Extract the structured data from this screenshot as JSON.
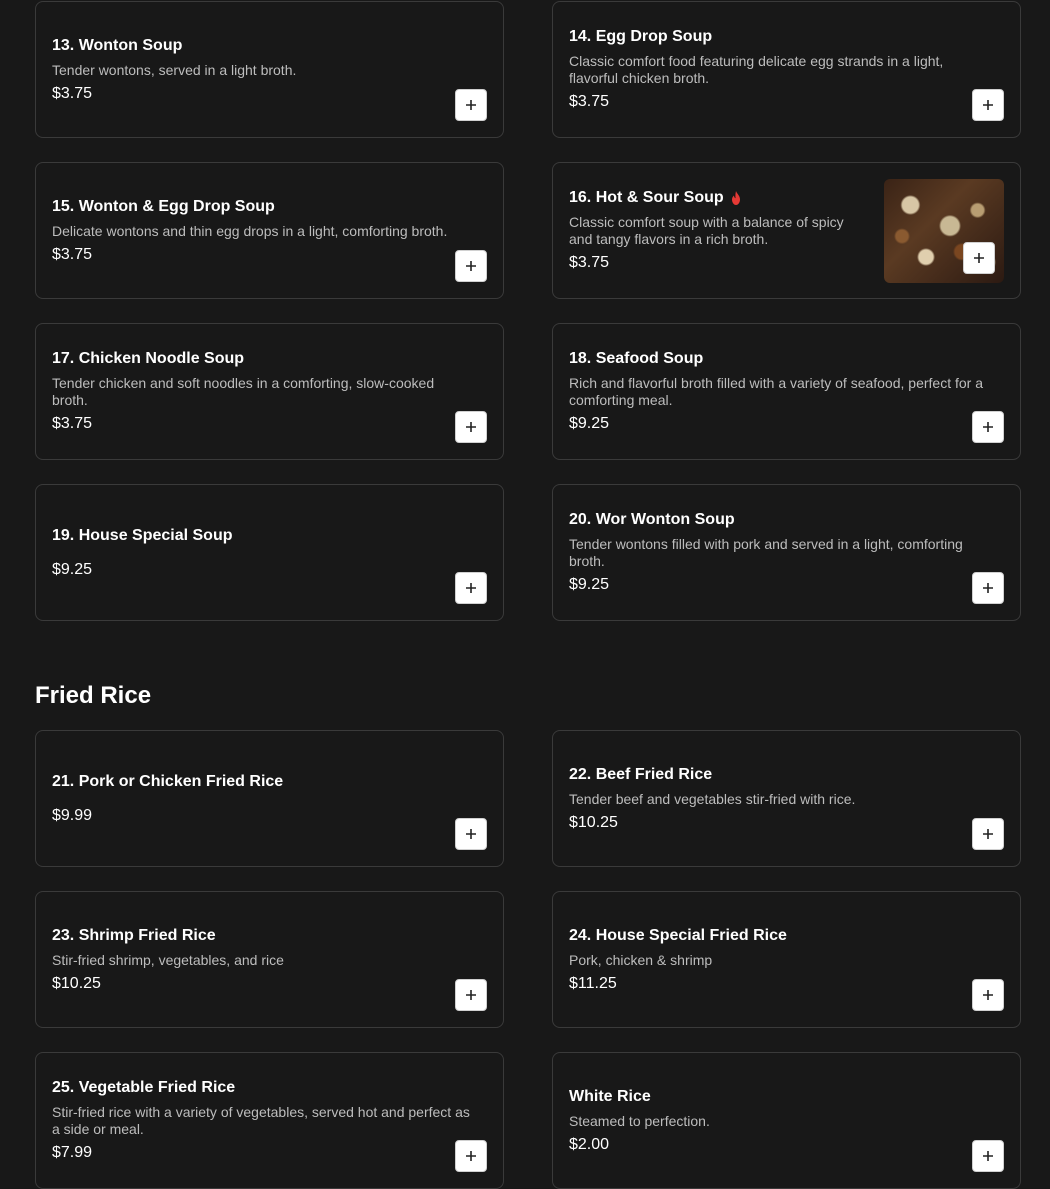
{
  "soups": [
    {
      "name": "13. Wonton Soup",
      "desc": "Tender wontons, served in a light broth.",
      "price": "$3.75"
    },
    {
      "name": "14. Egg Drop Soup",
      "desc": "Classic comfort food featuring delicate egg strands in a light, flavorful chicken broth.",
      "price": "$3.75"
    },
    {
      "name": "15. Wonton & Egg Drop Soup",
      "desc": "Delicate wontons and thin egg drops in a light, comforting broth.",
      "price": "$3.75"
    },
    {
      "name": "16. Hot & Sour Soup",
      "desc": "Classic comfort soup with a balance of spicy and tangy flavors in a rich broth.",
      "price": "$3.75",
      "badge_icon": "spicy-fire-icon",
      "has_image": true
    },
    {
      "name": "17. Chicken Noodle Soup",
      "desc": "Tender chicken and soft noodles in a comforting, slow-cooked broth.",
      "price": "$3.75"
    },
    {
      "name": "18. Seafood Soup",
      "desc": "Rich and flavorful broth filled with a variety of seafood, perfect for a comforting meal.",
      "price": "$9.25"
    },
    {
      "name": "19. House Special Soup",
      "desc": "",
      "price": "$9.25"
    },
    {
      "name": "20. Wor Wonton Soup",
      "desc": "Tender wontons filled with pork and served in a light, comforting broth.",
      "price": "$9.25"
    }
  ],
  "fried_rice_section": {
    "title": "Fried Rice"
  },
  "fried_rice": [
    {
      "name": "21. Pork or Chicken Fried Rice",
      "desc": "",
      "price": "$9.99"
    },
    {
      "name": "22. Beef Fried Rice",
      "desc": "Tender beef and vegetables stir-fried with rice.",
      "price": "$10.25"
    },
    {
      "name": "23. Shrimp Fried Rice",
      "desc": "Stir-fried shrimp, vegetables, and rice",
      "price": "$10.25"
    },
    {
      "name": "24. House Special Fried Rice",
      "desc": "Pork, chicken & shrimp",
      "price": "$11.25"
    },
    {
      "name": "25. Vegetable Fried Rice",
      "desc": "Stir-fried rice with a variety of vegetables, served hot and perfect as a side or meal.",
      "price": "$7.99"
    },
    {
      "name": "White Rice",
      "desc": "Steamed to perfection.",
      "price": "$2.00"
    }
  ],
  "colors": {
    "background": "#181818",
    "card_border": "#3a3a3a",
    "spicy_icon": "#e53935"
  }
}
